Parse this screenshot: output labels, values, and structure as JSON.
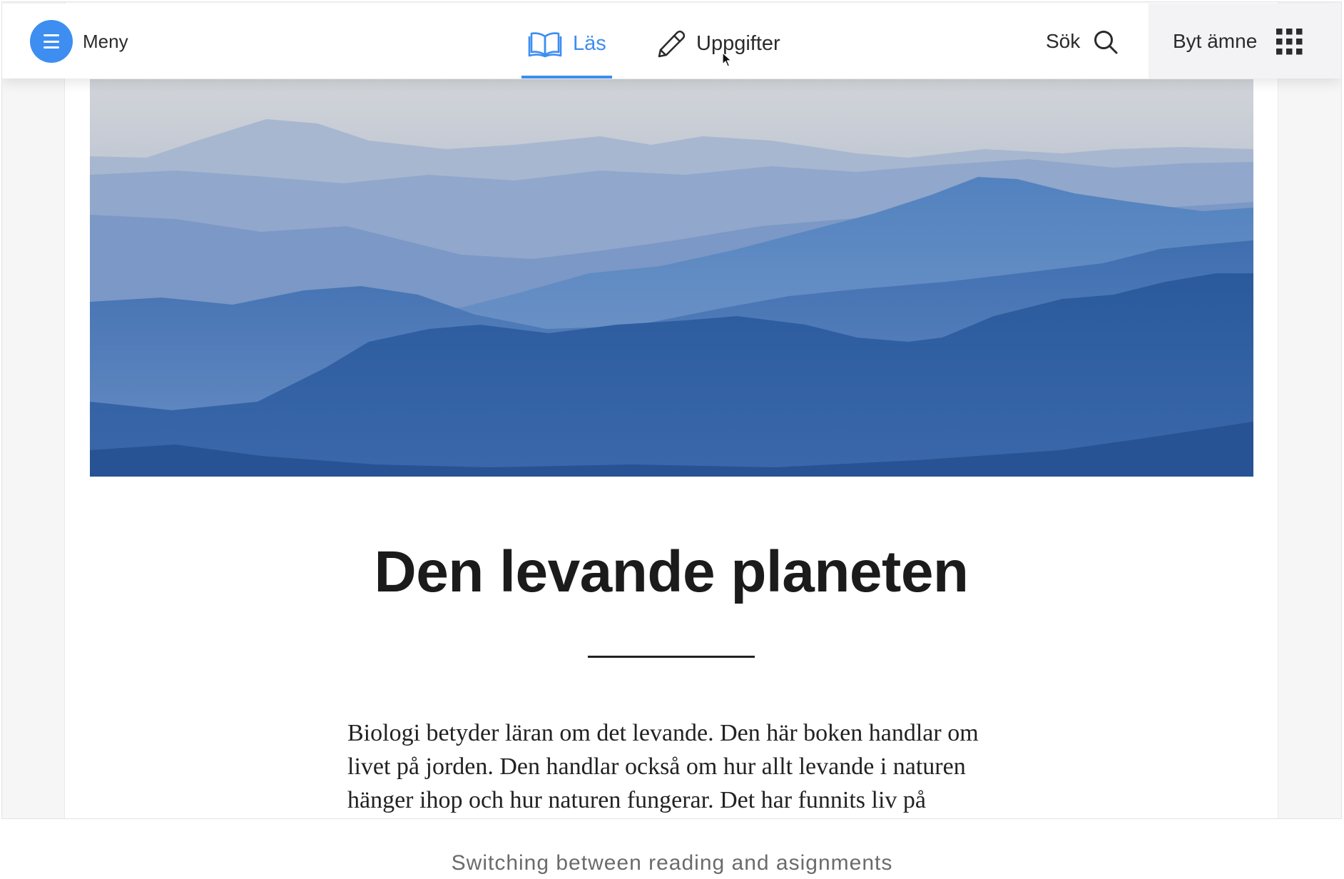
{
  "colors": {
    "accent": "#3d8ef0"
  },
  "header": {
    "menu_label": "Meny",
    "menu_icon": "hamburger-icon",
    "tabs": [
      {
        "label": "Läs",
        "icon": "book-open-icon",
        "active": true
      },
      {
        "label": "Uppgifter",
        "icon": "pencil-icon",
        "active": false
      }
    ],
    "search_label": "Sök",
    "search_icon": "search-icon",
    "switch_subject_label": "Byt ämne",
    "switch_subject_icon": "grid-icon"
  },
  "article": {
    "title": "Den levande planeten",
    "body_lines": [
      "Biologi betyder läran om det levande. Den här boken handlar om",
      "livet på jorden. Den handlar också om hur allt levande i naturen",
      "hänger ihop och hur naturen fungerar. Det har funnits liv på"
    ]
  },
  "caption": "Switching between reading and asignments"
}
